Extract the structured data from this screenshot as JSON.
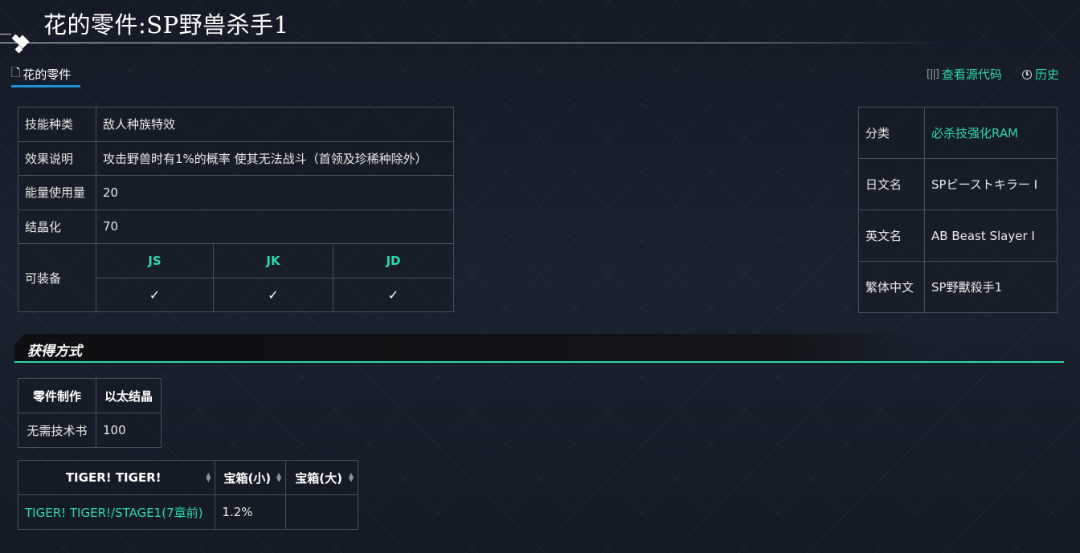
{
  "page": {
    "title": "花的零件:SP野兽杀手1"
  },
  "tabs": {
    "page_tab": "花的零件",
    "view_source": "查看源代码",
    "history": "历史"
  },
  "skill_table": {
    "rows": [
      {
        "label": "技能种类",
        "value": "敌人种族特效"
      },
      {
        "label": "效果说明",
        "value": "攻击野兽时有1%的概率 使其无法战斗（首领及珍稀种除外）"
      },
      {
        "label": "能量使用量",
        "value": "20"
      },
      {
        "label": "结晶化",
        "value": "70"
      }
    ],
    "equip_label": "可装备",
    "equip_classes": [
      "JS",
      "JK",
      "JD"
    ],
    "equip_checks": [
      "✓",
      "✓",
      "✓"
    ]
  },
  "info_table": {
    "rows": [
      {
        "label": "分类",
        "value": "必杀技强化RAM"
      },
      {
        "label": "日文名",
        "value": "SPビーストキラー I"
      },
      {
        "label": "英文名",
        "value": "AB Beast Slayer I"
      },
      {
        "label": "繁体中文",
        "value": "SP野獸殺手1"
      }
    ]
  },
  "acquire": {
    "section_title": "获得方式",
    "craft": {
      "headers": [
        "零件制作",
        "以太结晶"
      ],
      "row": [
        "无需技术书",
        "100"
      ]
    },
    "drops": {
      "headers": [
        "TIGER! TIGER!",
        "宝箱(小)",
        "宝箱(大)"
      ],
      "rows": [
        {
          "stage": "TIGER! TIGER!/STAGE1(7章前)",
          "small": "1.2%",
          "large": ""
        }
      ]
    }
  },
  "colors": {
    "accent": "#2ed8a8",
    "tab_underline": "#1e90d6",
    "background": "#151b27"
  }
}
